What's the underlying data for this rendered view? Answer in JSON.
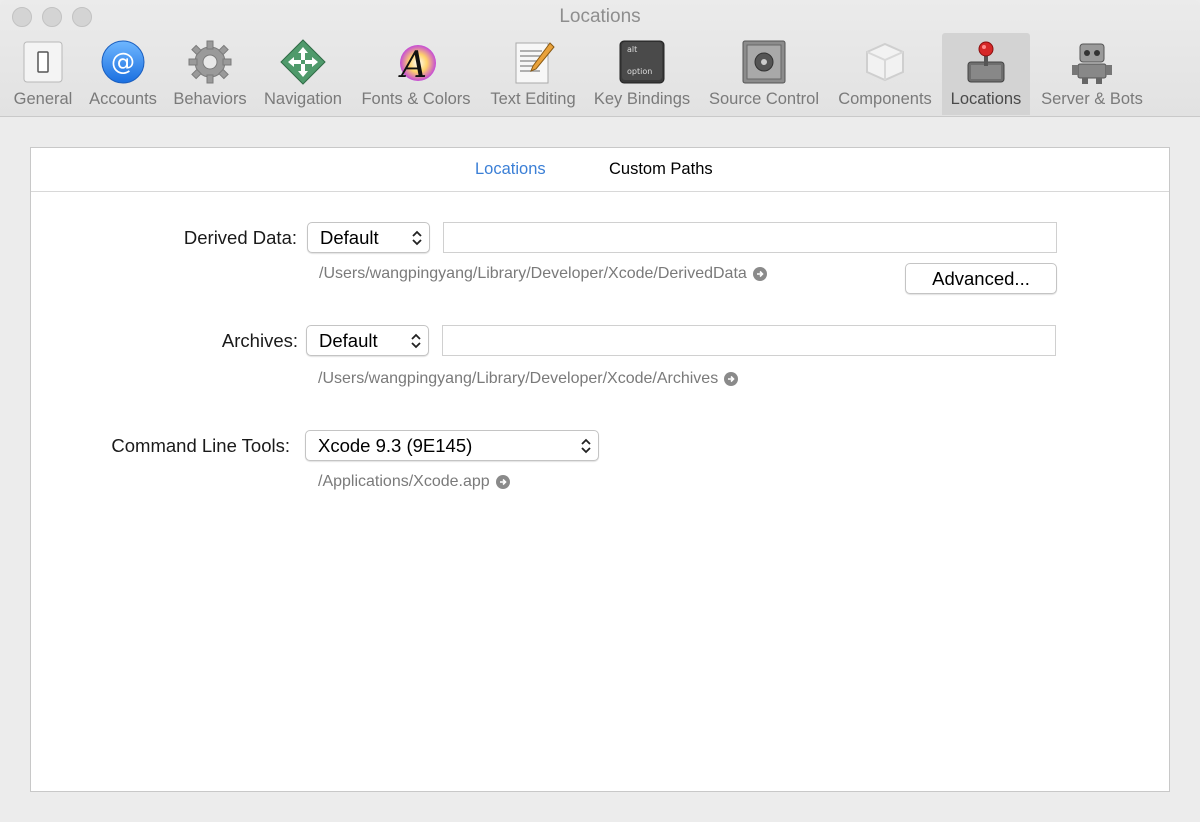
{
  "window": {
    "title": "Locations"
  },
  "toolbar": {
    "tabs": [
      {
        "label": "General",
        "icon": "general-icon"
      },
      {
        "label": "Accounts",
        "icon": "at-sign-icon"
      },
      {
        "label": "Behaviors",
        "icon": "gear-icon"
      },
      {
        "label": "Navigation",
        "icon": "navigation-arrows-icon"
      },
      {
        "label": "Fonts & Colors",
        "icon": "font-color-icon"
      },
      {
        "label": "Text Editing",
        "icon": "text-editing-icon"
      },
      {
        "label": "Key Bindings",
        "icon": "option-key-icon"
      },
      {
        "label": "Source Control",
        "icon": "safe-icon"
      },
      {
        "label": "Components",
        "icon": "components-box-icon"
      },
      {
        "label": "Locations",
        "icon": "joystick-icon"
      },
      {
        "label": "Server & Bots",
        "icon": "robot-icon"
      }
    ],
    "active_tab": "Locations",
    "key_caps": {
      "top": "alt",
      "bottom": "option"
    }
  },
  "segmented": {
    "items": [
      "Locations",
      "Custom Paths"
    ],
    "active": "Locations"
  },
  "derived_data": {
    "label": "Derived Data:",
    "popup_value": "Default",
    "field_value": "",
    "path": "/Users/wangpingyang/Library/Developer/Xcode/DerivedData",
    "advanced_button": "Advanced..."
  },
  "archives": {
    "label": "Archives:",
    "popup_value": "Default",
    "field_value": "",
    "path": "/Users/wangpingyang/Library/Developer/Xcode/Archives"
  },
  "command_line_tools": {
    "label": "Command Line Tools:",
    "popup_value": "Xcode 9.3 (9E145)",
    "path": "/Applications/Xcode.app"
  },
  "colors": {
    "accent": "#3b7fd6",
    "window_bg": "#ececec",
    "path_text": "#7a7a7a"
  }
}
